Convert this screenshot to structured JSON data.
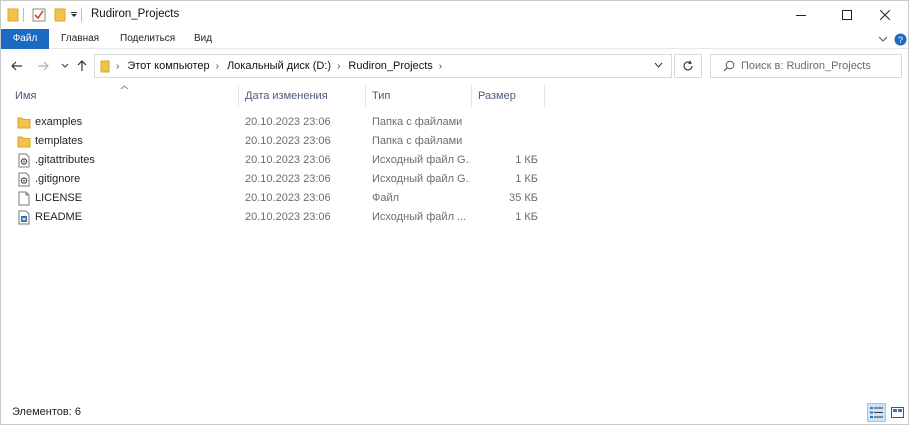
{
  "window": {
    "title": "Rudiron_Projects"
  },
  "ribbon": {
    "tabs": [
      "Файл",
      "Главная",
      "Поделиться",
      "Вид"
    ]
  },
  "address": {
    "crumbs": [
      "Этот компьютер",
      "Локальный диск (D:)",
      "Rudiron_Projects"
    ]
  },
  "search": {
    "placeholder": "Поиск в: Rudiron_Projects"
  },
  "columns": {
    "name": "Имя",
    "date": "Дата изменения",
    "type": "Тип",
    "size": "Размер"
  },
  "files": [
    {
      "name": "examples",
      "date": "20.10.2023 23:06",
      "type": "Папка с файлами",
      "size": "",
      "icon": "folder-icon"
    },
    {
      "name": "templates",
      "date": "20.10.2023 23:06",
      "type": "Папка с файлами",
      "size": "",
      "icon": "folder-icon"
    },
    {
      "name": ".gitattributes",
      "date": "20.10.2023 23:06",
      "type": "Исходный файл G...",
      "size": "1 КБ",
      "icon": "gear-file-icon"
    },
    {
      "name": ".gitignore",
      "date": "20.10.2023 23:06",
      "type": "Исходный файл G...",
      "size": "1 КБ",
      "icon": "gear-file-icon"
    },
    {
      "name": "LICENSE",
      "date": "20.10.2023 23:06",
      "type": "Файл",
      "size": "35 КБ",
      "icon": "blank-file-icon"
    },
    {
      "name": "README",
      "date": "20.10.2023 23:06",
      "type": "Исходный файл ...",
      "size": "1 КБ",
      "icon": "readme-file-icon"
    }
  ],
  "status": {
    "count_text": "Элементов: 6"
  },
  "colors": {
    "file_tab": "#1a6bc4",
    "folder": "#f3c349",
    "header_text": "#4d5b78"
  }
}
